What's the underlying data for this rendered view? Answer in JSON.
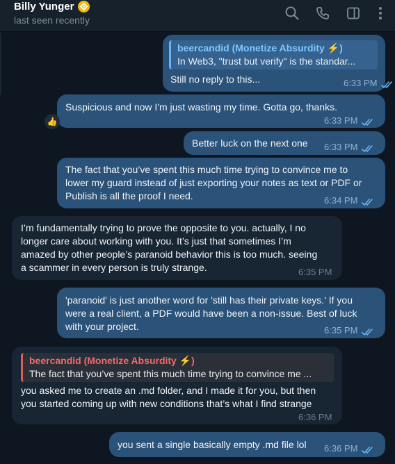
{
  "header": {
    "contact_name": "Billy Yunger",
    "status": "last seen recently",
    "icons": [
      "verified-badge-icon",
      "search-icon",
      "phone-icon",
      "sidebar-panel-icon",
      "more-vertical-icon"
    ]
  },
  "messages": [
    {
      "direction": "out",
      "reply_to": {
        "name": "beercandid (Monetize Absurdity ⚡️)",
        "text": "In Web3, \"trust but verify\" is the standar..."
      },
      "text": "Still no reply to this...",
      "time": "6:33 PM",
      "read": true
    },
    {
      "direction": "out",
      "text": "Suspicious and now I'm just wasting my time. Gotta go, thanks.",
      "time": "6:33 PM",
      "read": true,
      "reaction": "👍"
    },
    {
      "direction": "out",
      "text": "Better luck on the next one",
      "time": "6:33 PM",
      "read": true
    },
    {
      "direction": "out",
      "lines": [
        "The fact that you’ve spent this much time trying to convince me to",
        "lower my guard instead of just exporting your notes as text or PDF or",
        "Publish is all the proof I need."
      ],
      "time": "6:34 PM",
      "read": true
    },
    {
      "direction": "in",
      "lines": [
        "I’m fundamentally trying to prove the opposite to you. actually, I no",
        "longer care about working with you. It’s just that sometimes I’m",
        "amazed by other people’s paranoid behavior this is too much. seeing",
        "a scammer in every person is truly strange."
      ],
      "time": "6:35 PM"
    },
    {
      "direction": "out",
      "lines": [
        "'paranoid' is just another word for 'still has their private keys.' If you",
        "were a real client, a PDF would have been a non-issue. Best of luck",
        "with your project."
      ],
      "time": "6:35 PM",
      "read": true
    },
    {
      "direction": "in",
      "reply_to": {
        "name": "beercandid (Monetize Absurdity ⚡️)",
        "text": "The fact that you’ve spent this much time trying to convince me ..."
      },
      "lines": [
        "you asked me to create an .md folder, and I made it for you, but then",
        "you started coming up with new conditions that’s what I find strange"
      ],
      "time": "6:36 PM"
    },
    {
      "direction": "out",
      "text": "you sent a single basically empty .md file lol",
      "time": "6:36 PM",
      "read": true
    }
  ],
  "colors": {
    "background": "#0e1621",
    "header": "#17212b",
    "outgoing_bubble": "#2b5278",
    "incoming_bubble": "#182533",
    "reply_name_out": "#80c7ff",
    "reply_name_in": "#f36a6a"
  }
}
